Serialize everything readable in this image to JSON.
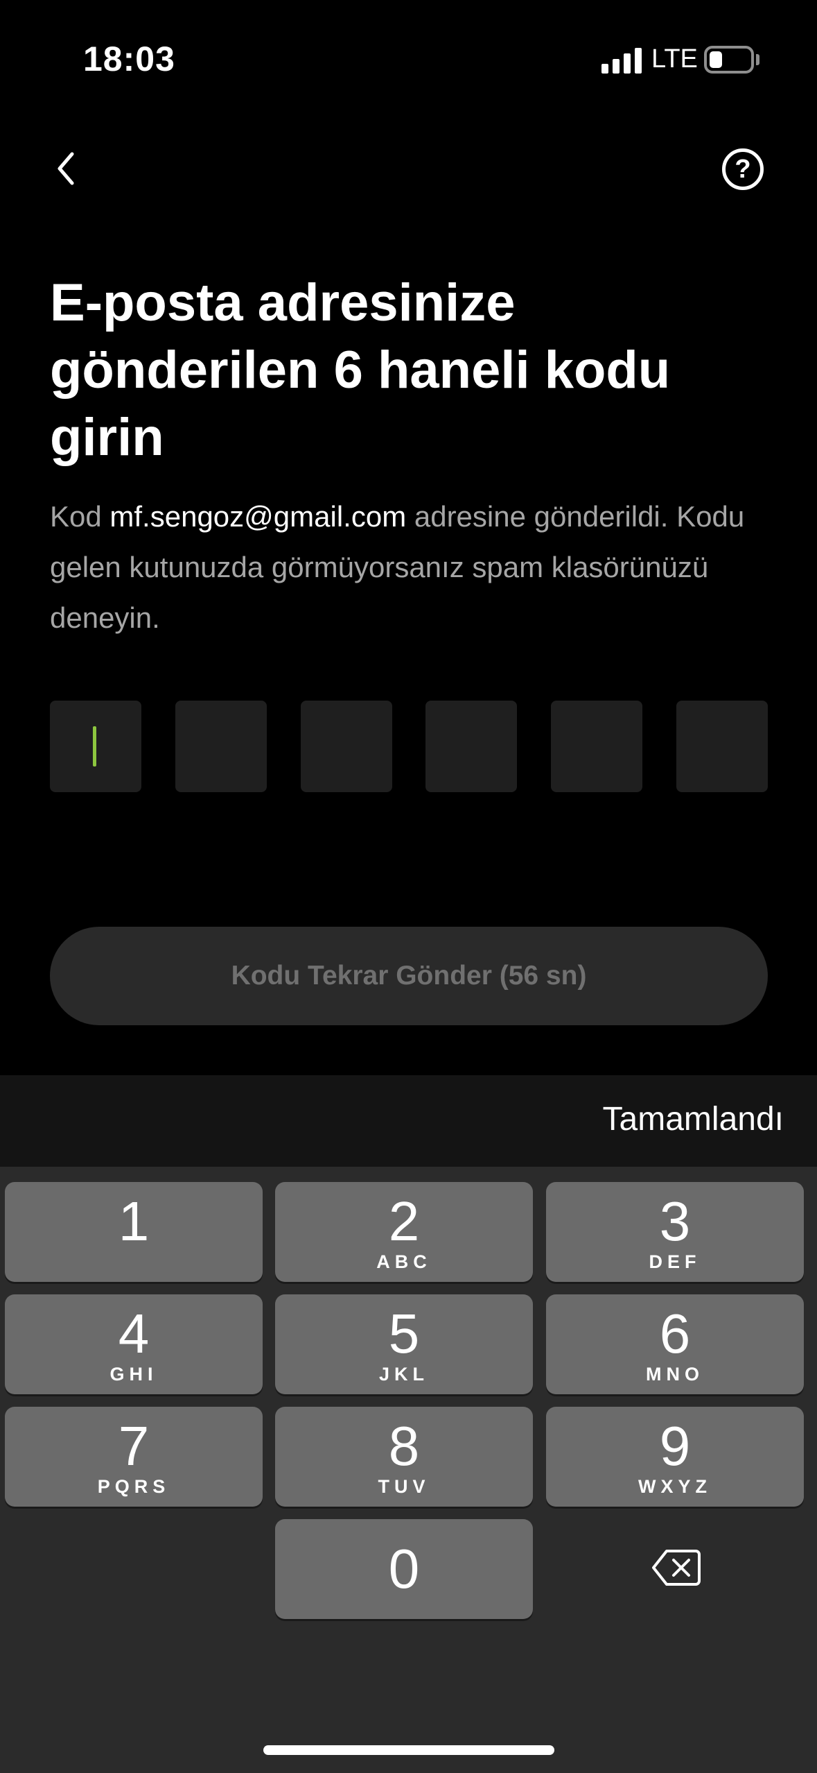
{
  "status_bar": {
    "time": "18:03",
    "network": "LTE",
    "signal_bars": 4,
    "icons": [
      "signal-icon",
      "battery-icon"
    ]
  },
  "nav": {
    "back_icon": "chevron-left-icon",
    "help_icon": "question-circle-icon",
    "help_glyph": "?"
  },
  "heading": {
    "title": "E-posta adresinize gönderilen 6 haneli kodu girin"
  },
  "description": {
    "prefix": "Kod ",
    "email": "mf.sengoz@gmail.com",
    "suffix": " adresine gönderildi. Kodu gelen kutunuzda görmüyorsanız spam klasörünüzü deneyin."
  },
  "code_input": {
    "length": 6,
    "values": [
      "",
      "",
      "",
      "",
      "",
      ""
    ],
    "active_index": 0
  },
  "resend_button": {
    "label": "Kodu Tekrar Gönder (56 sn)",
    "enabled": false
  },
  "keyboard": {
    "done_label": "Tamamlandı",
    "keys": [
      {
        "digit": "1",
        "letters": ""
      },
      {
        "digit": "2",
        "letters": "ABC"
      },
      {
        "digit": "3",
        "letters": "DEF"
      },
      {
        "digit": "4",
        "letters": "GHI"
      },
      {
        "digit": "5",
        "letters": "JKL"
      },
      {
        "digit": "6",
        "letters": "MNO"
      },
      {
        "digit": "7",
        "letters": "PQRS"
      },
      {
        "digit": "8",
        "letters": "TUV"
      },
      {
        "digit": "9",
        "letters": "WXYZ"
      },
      {
        "digit": "0",
        "letters": ""
      }
    ],
    "delete_icon": "backspace-icon"
  },
  "colors": {
    "background": "#000000",
    "accent_caret": "#8dc63f",
    "muted_text": "#a6a6a6",
    "key_fill": "#6b6b6b"
  }
}
